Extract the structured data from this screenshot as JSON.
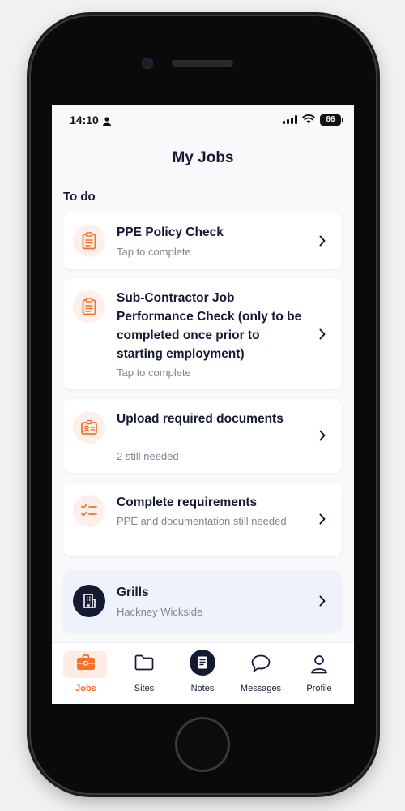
{
  "status_bar": {
    "time": "14:10",
    "battery": "86"
  },
  "header": {
    "title": "My Jobs"
  },
  "section": {
    "label": "To do"
  },
  "tasks": [
    {
      "title": "PPE Policy Check",
      "subtitle": "Tap to complete",
      "icon": "clipboard-icon"
    },
    {
      "title": "Sub-Contractor Job Performance Check (only to be completed once prior to starting employment)",
      "subtitle": "Tap to complete",
      "icon": "clipboard-icon"
    },
    {
      "title": "Upload required documents",
      "subtitle": "2 still needed",
      "icon": "id-badge-icon"
    },
    {
      "title": "Complete requirements",
      "subtitle": "PPE and documentation still needed",
      "icon": "checklist-icon"
    }
  ],
  "job": {
    "title": "Grills",
    "subtitle": "Hackney Wickside",
    "icon": "building-icon"
  },
  "tabs": [
    {
      "label": "Jobs",
      "icon": "briefcase-icon",
      "active": true
    },
    {
      "label": "Sites",
      "icon": "folder-icon",
      "active": false
    },
    {
      "label": "Notes",
      "icon": "notes-icon",
      "active": false
    },
    {
      "label": "Messages",
      "icon": "chat-bubble-icon",
      "active": false
    },
    {
      "label": "Profile",
      "icon": "person-icon",
      "active": false
    }
  ],
  "colors": {
    "accent": "#f4722b",
    "navy": "#141a33",
    "muted": "#808594",
    "card_highlight": "#eef2fa"
  }
}
